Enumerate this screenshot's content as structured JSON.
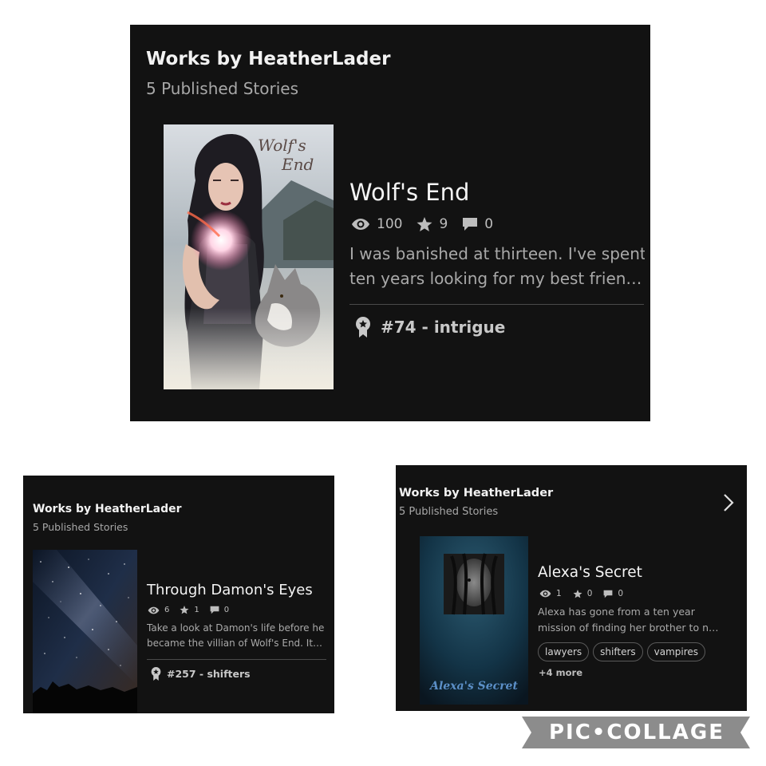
{
  "panels": [
    {
      "header_title": "Works by HeatherLader",
      "published_count": "5 Published Stories",
      "story": {
        "title": "Wolf's End",
        "cover_text": "Wolf's End",
        "stats": {
          "views": "100",
          "votes": "9",
          "comments": "0"
        },
        "description": [
          "I was banished at thirteen. I've spent",
          "ten years looking for my best frien…"
        ],
        "ranking": "#74 - intrigue"
      }
    },
    {
      "header_title": "Works by HeatherLader",
      "published_count": "5 Published Stories",
      "story": {
        "title": "Through Damon's Eyes",
        "stats": {
          "views": "6",
          "votes": "1",
          "comments": "0"
        },
        "description": [
          "Take a look at Damon's life before he",
          "became the villian of Wolf's End. It…"
        ],
        "ranking": "#257 - shifters"
      }
    },
    {
      "header_title": "Works by HeatherLader",
      "published_count": "5 Published Stories",
      "story": {
        "title": "Alexa's Secret",
        "cover_text": "Alexa's Secret",
        "stats": {
          "views": "1",
          "votes": "0",
          "comments": "0"
        },
        "description": [
          "Alexa has gone from a ten year",
          "mission of finding her brother to n…"
        ],
        "tags": [
          "lawyers",
          "shifters",
          "vampires"
        ],
        "more_tags": "+4 more"
      }
    }
  ],
  "watermark": "PIC•COLLAGE",
  "icons": [
    "eye-icon",
    "star-icon",
    "comment-icon",
    "ribbon-icon",
    "chevron-right-icon"
  ],
  "colors": {
    "panel_bg": "#121212",
    "text_primary": "#f4f4f4",
    "text_muted": "#a9a9a9",
    "badge_gray": "#8c8c8c"
  }
}
